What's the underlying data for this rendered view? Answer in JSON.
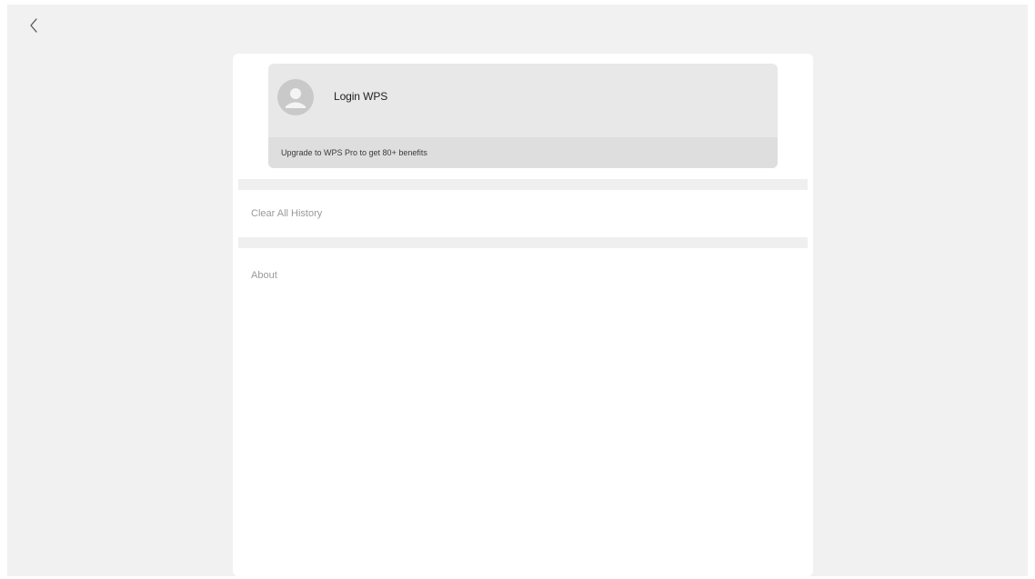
{
  "header": {
    "back_icon": "chevron-left-icon"
  },
  "account": {
    "avatar_icon": "user-avatar-icon",
    "login_label": "Login WPS",
    "upgrade_text": "Upgrade to WPS Pro to get 80+ benefits"
  },
  "menu": {
    "items": [
      {
        "label": "Clear All History"
      },
      {
        "label": "About"
      }
    ]
  },
  "colors": {
    "background": "#f1f1f1",
    "panel": "#ffffff",
    "card": "#e8e8e8",
    "upgrade_bar": "#dedede",
    "muted_text": "#9a9a9a"
  }
}
